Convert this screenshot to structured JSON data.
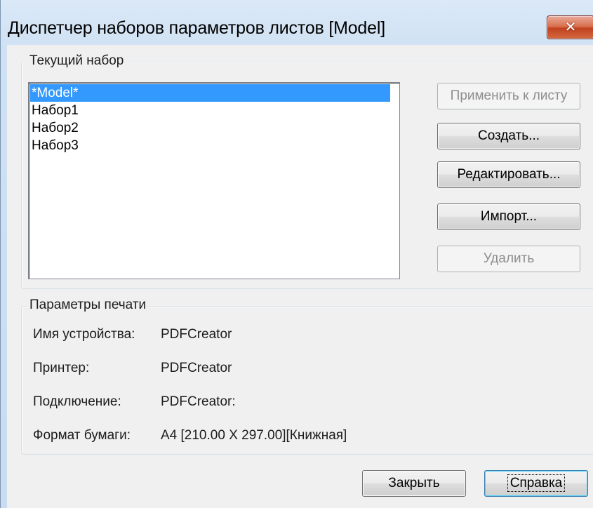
{
  "window": {
    "title": "Диспетчер наборов параметров листов [Model]",
    "close_glyph": "✕"
  },
  "current_set": {
    "group_label": "Текущий набор",
    "items": [
      "*Model*",
      "Набор1",
      "Набор2",
      "Набор3"
    ],
    "selected_index": 0
  },
  "buttons": {
    "apply_to_layout": "Применить к листу",
    "new": "Создать...",
    "modify": "Редактировать...",
    "import": "Импорт...",
    "delete": "Удалить",
    "close": "Закрыть",
    "help": "Справка"
  },
  "print_params": {
    "group_label": "Параметры печати",
    "device_label": "Имя устройства:",
    "device_value": "PDFCreator",
    "printer_label": "Принтер:",
    "printer_value": "PDFCreator",
    "connection_label": "Подключение:",
    "connection_value": "PDFCreator:",
    "paper_label": "Формат бумаги:",
    "paper_value": "A4 [210.00 X 297.00][Книжная]"
  },
  "colors": {
    "selection": "#3399ff",
    "close_button": "#c7502c"
  }
}
